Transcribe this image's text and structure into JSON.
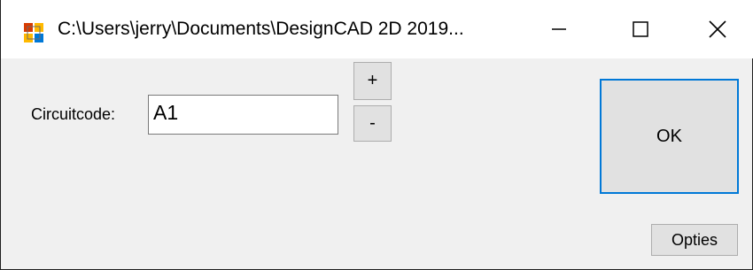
{
  "window": {
    "title": "C:\\Users\\jerry\\Documents\\DesignCAD 2D 2019...",
    "app_icon": "designcad-app-icon",
    "controls": {
      "minimize_icon": "minimize-icon",
      "maximize_icon": "maximize-icon",
      "close_icon": "close-icon"
    }
  },
  "form": {
    "circuit_label": "Circuitcode:",
    "circuit_value": "A1",
    "plus_label": "+",
    "minus_label": "-",
    "ok_label": "OK",
    "options_label": "Opties"
  },
  "colors": {
    "accent": "#0078d7",
    "dialog_bg": "#f0f0f0",
    "button_bg": "#e1e1e1"
  }
}
